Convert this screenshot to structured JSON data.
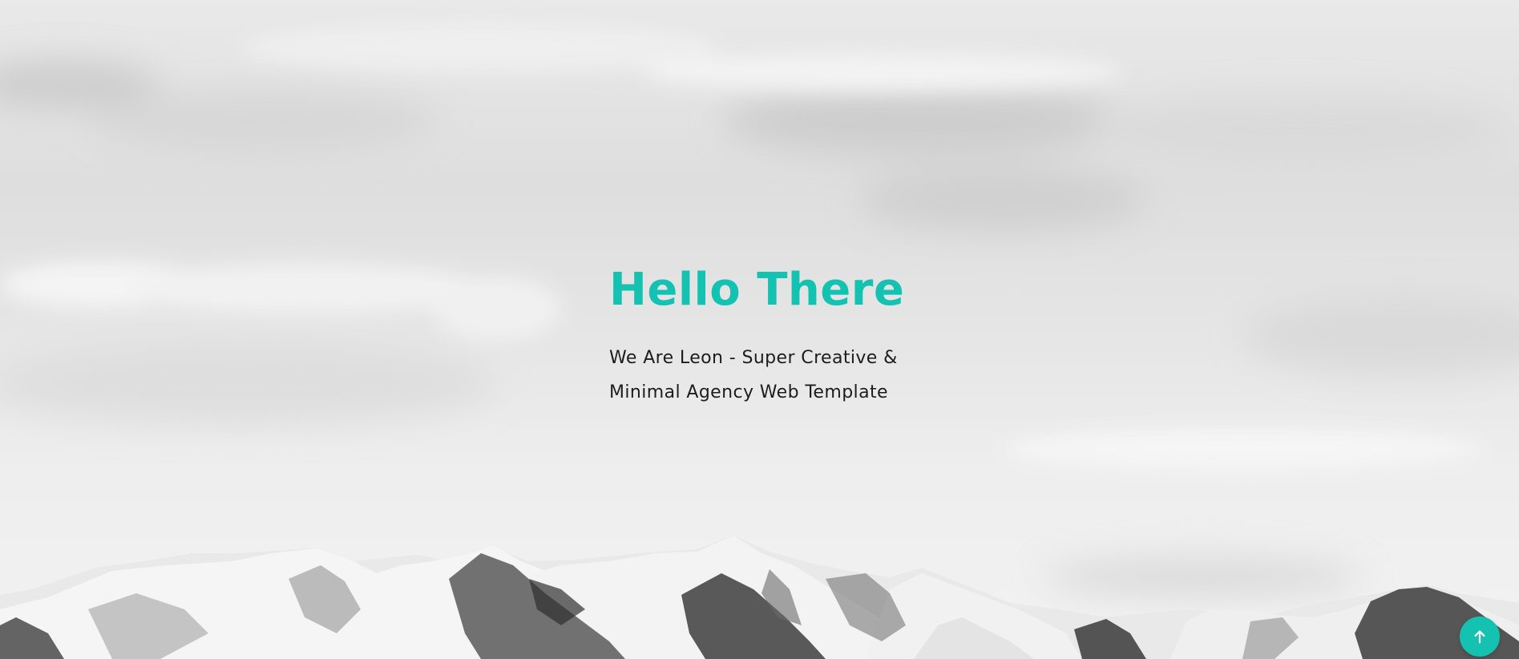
{
  "hero": {
    "title": "Hello There",
    "subtitle_line1": "We Are Leon - Super Creative &",
    "subtitle_line2": "Minimal Agency Web Template"
  },
  "scroll_to_top": {
    "icon": "arrow-up-icon"
  },
  "colors": {
    "accent": "#14c2b1",
    "text": "#1d1d1d",
    "sky": "#e6e6e6"
  },
  "background": {
    "description_icon": "mountain-landscape-image"
  }
}
